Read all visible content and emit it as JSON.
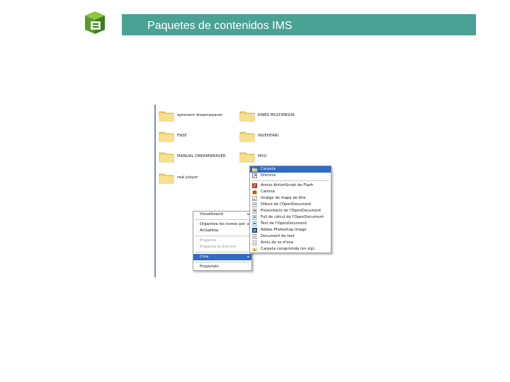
{
  "header": {
    "title": "Paquetes de contenidos IMS",
    "accent_color": "#4aa294",
    "logo_icon": "green-cube-logo-icon"
  },
  "folders": [
    {
      "label": "aprenent dreamweaver",
      "icon": "folder-icon"
    },
    {
      "label": "EINES MULTIMEDIA",
      "icon": "folder-icon"
    },
    {
      "label": "FNSF",
      "icon": "folder-icon"
    },
    {
      "label": "INVENTARI",
      "icon": "folder-icon"
    },
    {
      "label": "MANUAL DREAMWEAVER",
      "icon": "folder-icon"
    },
    {
      "label": "MVU",
      "icon": "folder-icon"
    },
    {
      "label": "real player",
      "icon": "folder-icon"
    }
  ],
  "context_menu": {
    "items": [
      {
        "label": "Visualització",
        "submenu": true
      },
      {
        "label": "Organitza les icones per",
        "submenu": true
      },
      {
        "label": "Actualitza"
      },
      {
        "label": "Enganxa",
        "disabled": true
      },
      {
        "label": "Enganxa la drecera",
        "disabled": true
      },
      {
        "label": "Crea",
        "submenu": true,
        "highlighted": true
      },
      {
        "label": "Propietats"
      }
    ],
    "submenu_arrow": "▸"
  },
  "submenu": {
    "items": [
      {
        "label": "Carpeta",
        "icon": "folder-icon",
        "highlighted": true
      },
      {
        "label": "Drecera",
        "icon": "shortcut-icon"
      },
      {
        "label": "Arxivo ActionScript de Flash",
        "icon": "flash-icon"
      },
      {
        "label": "Cartera",
        "icon": "briefcase-icon"
      },
      {
        "label": "Imatge de mapa de bits",
        "icon": "bitmap-icon"
      },
      {
        "label": "Dibuix de l'OpenDocument",
        "icon": "document-icon"
      },
      {
        "label": "Presentació de l'OpenDocument",
        "icon": "document-icon"
      },
      {
        "label": "Full de càlcul de l'OpenDocument",
        "icon": "document-icon"
      },
      {
        "label": "Text de l'OpenDocument",
        "icon": "document-icon"
      },
      {
        "label": "Adobe Photoshop Image",
        "icon": "photoshop-icon"
      },
      {
        "label": "Document de text",
        "icon": "text-file-icon"
      },
      {
        "label": "Arxiu de so d'ona",
        "icon": "sound-file-icon"
      },
      {
        "label": "Carpeta comprimida (en zip)",
        "icon": "zip-folder-icon"
      }
    ]
  }
}
